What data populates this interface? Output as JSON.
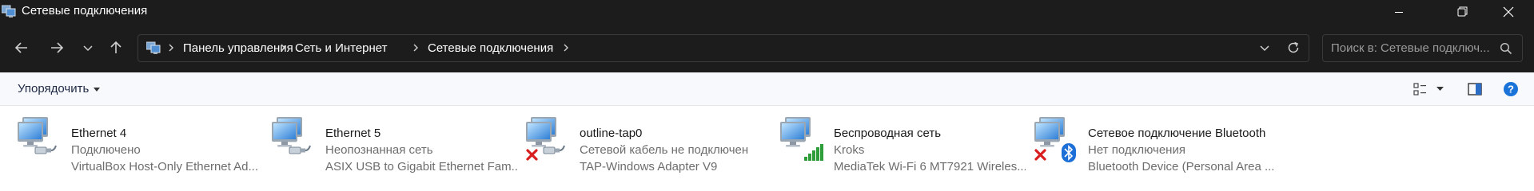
{
  "window": {
    "title": "Сетевые подключения"
  },
  "breadcrumb": [
    "Панель управления",
    "Сеть и Интернет",
    "Сетевые подключения"
  ],
  "search": {
    "placeholder": "Поиск в: Сетевые подключ..."
  },
  "toolbar": {
    "organize_label": "Упорядочить"
  },
  "connections": [
    {
      "name": "Ethernet 4",
      "status": "Подключено",
      "device": "VirtualBox Host-Only Ethernet Ad...",
      "icon": "ethernet-connected-icon",
      "error": false
    },
    {
      "name": "Ethernet 5",
      "status": "Неопознанная сеть",
      "device": "ASIX USB to Gigabit Ethernet Fam...",
      "icon": "ethernet-connected-icon",
      "error": false
    },
    {
      "name": "outline-tap0",
      "status": "Сетевой кабель не подключен",
      "device": "TAP-Windows Adapter V9",
      "icon": "ethernet-disconnected-icon",
      "error": true
    },
    {
      "name": "Беспроводная сеть",
      "status": "Kroks",
      "device": "MediaTek Wi-Fi 6 MT7921 Wireles...",
      "icon": "wifi-signal-icon",
      "error": false
    },
    {
      "name": "Сетевое подключение Bluetooth",
      "status": "Нет подключения",
      "device": "Bluetooth Device (Personal Area ...",
      "icon": "bluetooth-icon",
      "error": true
    }
  ],
  "colors": {
    "titlebar_bg": "#1c1c1c",
    "commandbar_bg": "#f7f9fc",
    "accent": "#0067c0",
    "error_red": "#d81e1e"
  }
}
